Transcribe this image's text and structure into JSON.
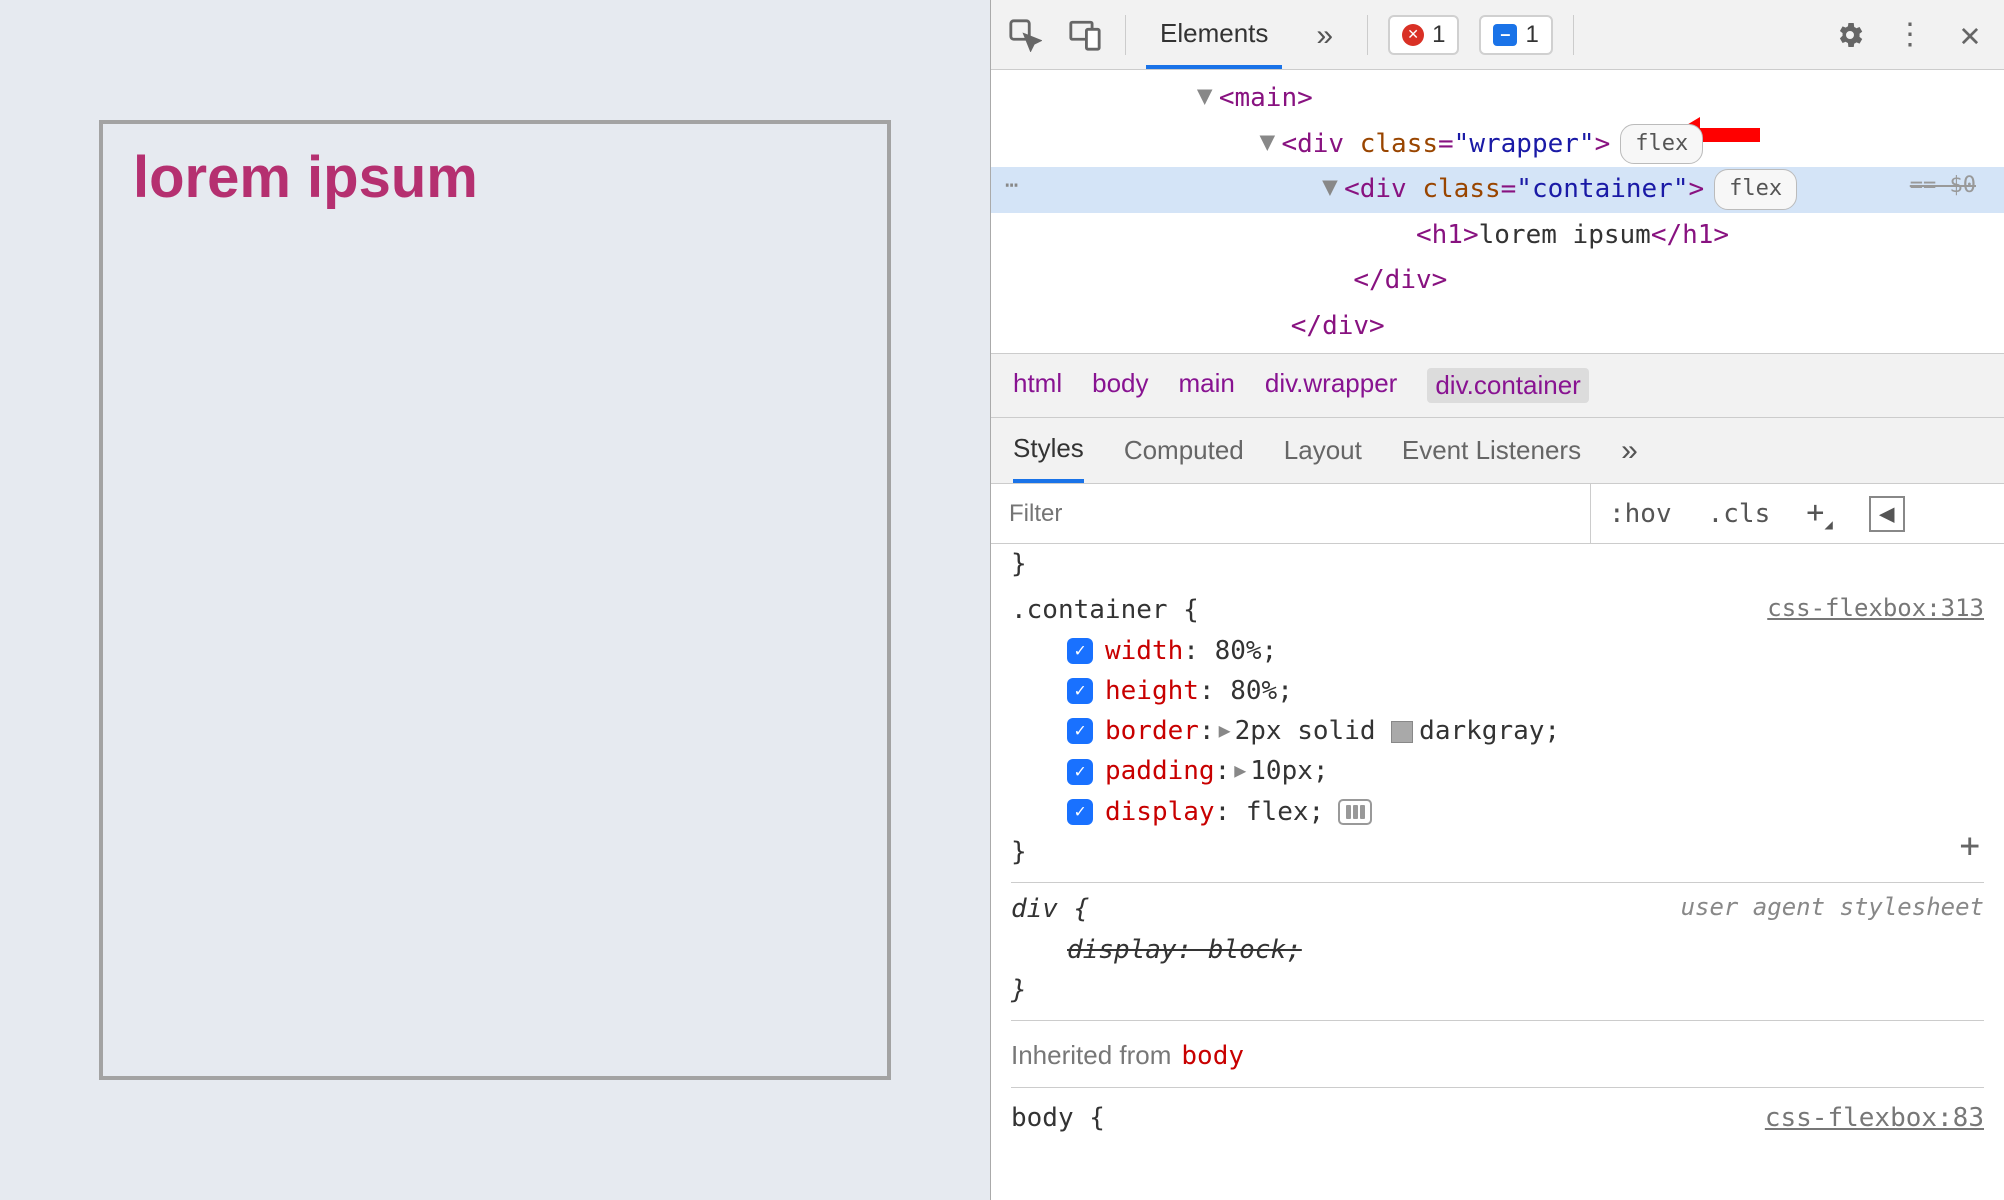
{
  "preview": {
    "heading": "lorem ipsum"
  },
  "toolbar": {
    "tab_elements": "Elements",
    "overflow": "»",
    "error_count": "1",
    "message_count": "1"
  },
  "dom": {
    "line1_open": "<main>",
    "line2_open": "<div ",
    "line2_attr_name": "class",
    "line2_attr_val": "\"wrapper\"",
    "line2_close": ">",
    "line2_pill": "flex",
    "line3_open": "<div ",
    "line3_attr_name": "class",
    "line3_attr_val": "\"container\"",
    "line3_close": ">",
    "line3_pill": "flex",
    "line3_tail": "== $0",
    "line4": "<h1>lorem ipsum</h1>",
    "line4_tagopen": "<h1>",
    "line4_text": "lorem ipsum",
    "line4_tagclose": "</h1>",
    "line5": "</div>",
    "line6": "</div>",
    "ellipsis": "⋯"
  },
  "breadcrumb": {
    "items": [
      "html",
      "body",
      "main",
      "div.wrapper",
      "div.container"
    ]
  },
  "styles_tabs": {
    "styles": "Styles",
    "computed": "Computed",
    "layout": "Layout",
    "events": "Event Listeners",
    "more": "»"
  },
  "filter": {
    "placeholder": "Filter",
    "hov": ":hov",
    "cls": ".cls"
  },
  "rules": {
    "container": {
      "selector": ".container {",
      "source": "css-flexbox:313",
      "decls": [
        {
          "prop": "width",
          "val": "80%;"
        },
        {
          "prop": "height",
          "val": "80%;"
        },
        {
          "prop": "border",
          "tri": true,
          "swatch": true,
          "val": "2px solid ",
          "val2": "darkgray;"
        },
        {
          "prop": "padding",
          "tri": true,
          "val": "10px;"
        },
        {
          "prop": "display",
          "val": "flex;",
          "flex_hint": true
        }
      ],
      "close": "}"
    },
    "div": {
      "selector": "div {",
      "source": "user agent stylesheet",
      "decl_over": "display: block;",
      "close": "}"
    },
    "inherited_label": "Inherited from",
    "inherited_from": "body",
    "bottom_sel": "body {",
    "bottom_src": "css-flexbox:83"
  }
}
